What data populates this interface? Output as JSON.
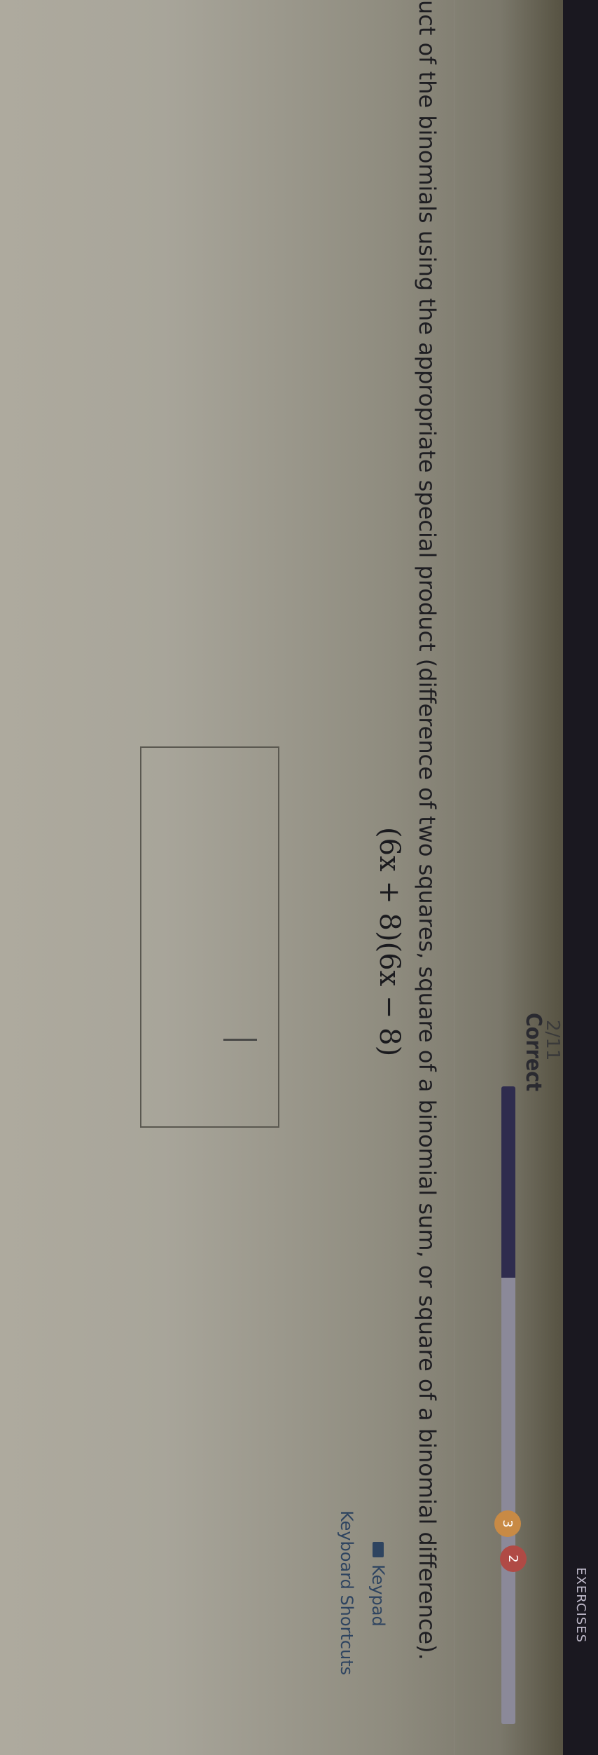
{
  "header": {
    "section_label": "EXERCISES",
    "score_fraction": "2/11",
    "status": "Correct",
    "progress_fraction": 0.3
  },
  "badges": {
    "orange": "3",
    "red": "2"
  },
  "question": {
    "instruction": "uct of the binomials using the appropriate special product (difference of two squares, square of a binomial sum, or square of a binomial difference).",
    "expression": "(6x + 8)(6x − 8)"
  },
  "answer": {
    "value": ""
  },
  "links": {
    "keypad": "Keypad",
    "shortcuts": "Keyboard Shortcuts"
  }
}
